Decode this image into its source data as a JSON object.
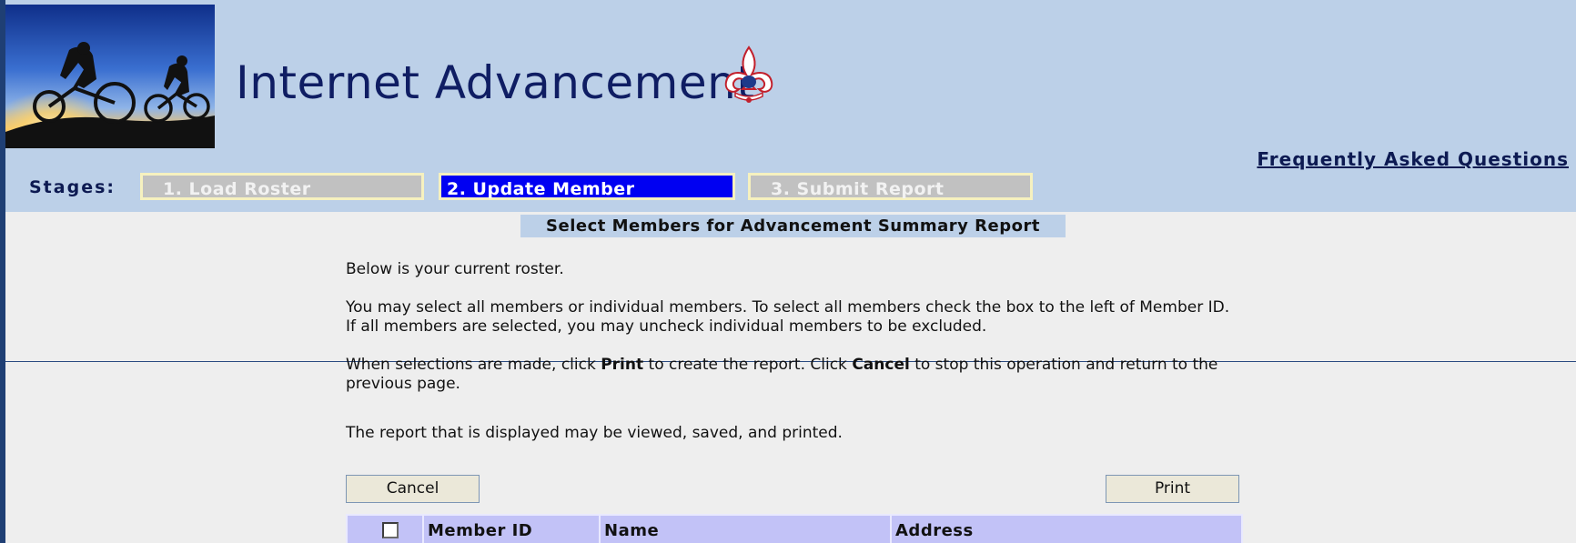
{
  "header": {
    "app_title": "Internet Advancement",
    "faq_link": "Frequently Asked Questions"
  },
  "stages": {
    "label": "Stages:",
    "items": [
      {
        "label": "1. Load Roster",
        "state": "inactive"
      },
      {
        "label": "2. Update Member",
        "state": "active"
      },
      {
        "label": "3. Submit Report",
        "state": "inactive"
      }
    ]
  },
  "main": {
    "title": "Select Members for Advancement Summary Report",
    "intro": "Below is your current roster.",
    "select_instructions": "You may select all members or individual members. To select all members check the box to the left of Member ID. If all members are selected, you may uncheck individual members to be excluded.",
    "print_instructions": {
      "part1": "When selections are made, click ",
      "print_word": "Print",
      "part2": " to create the report. Click ",
      "cancel_word": "Cancel",
      "part3": " to stop this operation and return to the previous page."
    },
    "report_note": "The report that is displayed may be viewed, saved, and printed."
  },
  "buttons": {
    "cancel_label": "Cancel",
    "print_label": "Print"
  },
  "roster_table": {
    "select_all_checked": false,
    "columns": [
      "Member ID",
      "Name",
      "Address"
    ]
  },
  "colors": {
    "header_bg": "#bcd0e8",
    "active_stage": "#0000f2",
    "inactive_stage": "#c1c1c1",
    "table_header_bg": "#c2c2f7",
    "title_text": "#0f1d63"
  }
}
